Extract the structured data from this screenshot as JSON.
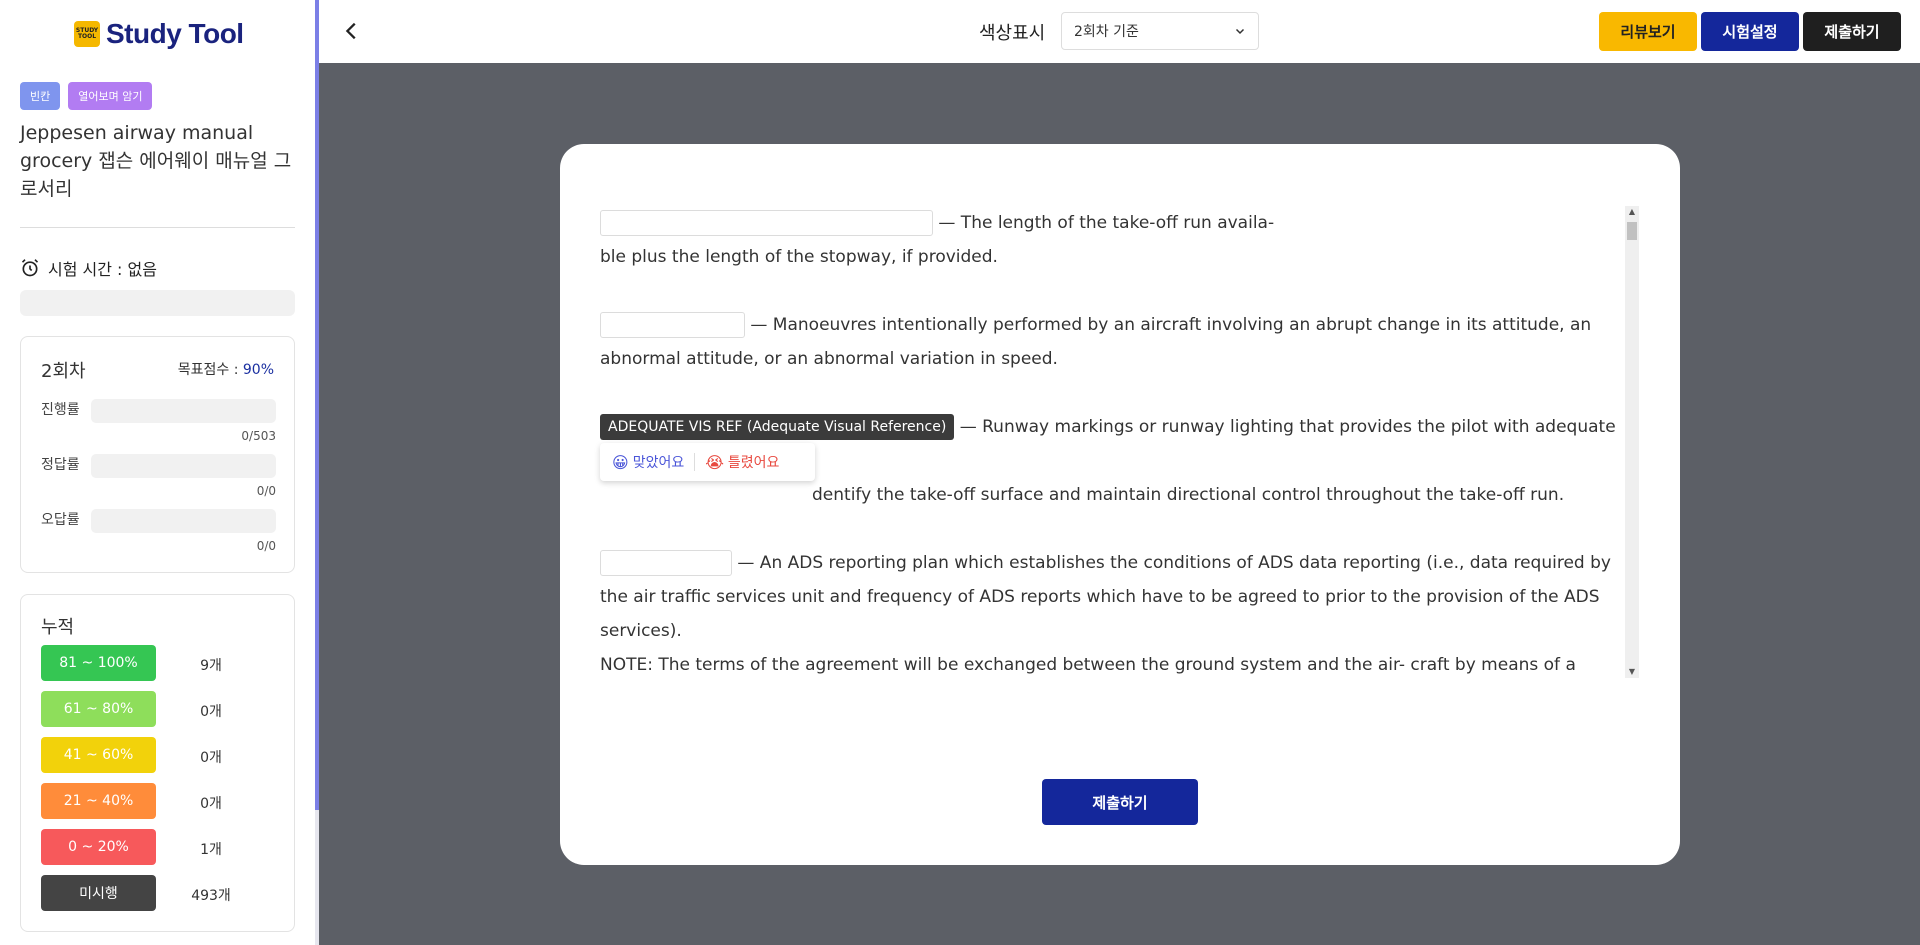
{
  "app": {
    "logo_badge": "STUDY TOOL",
    "logo_text": "Study Tool"
  },
  "sidebar": {
    "tags": [
      "빈칸",
      "열어보며 암기"
    ],
    "title": "Jeppesen airway manual grocery 잽슨 에어웨이 매뉴얼 그로서리",
    "timer_label": "시험 시간 : 없음",
    "round": {
      "name": "2회차",
      "goal_label": "목표점수 : ",
      "goal_value": "90%",
      "stats": [
        {
          "label": "진행률",
          "count": "0/503",
          "progress": 0
        },
        {
          "label": "정답률",
          "count": "0/0",
          "progress": 0
        },
        {
          "label": "오답률",
          "count": "0/0",
          "progress": 0
        }
      ]
    },
    "cumulative": {
      "title": "누적",
      "rows": [
        {
          "range": "81 ~ 100%",
          "count": "9개",
          "color": "#35c653"
        },
        {
          "range": "61 ~ 80%",
          "count": "0개",
          "color": "#8ede5b"
        },
        {
          "range": "41 ~ 60%",
          "count": "0개",
          "color": "#f2d20b"
        },
        {
          "range": "21 ~ 40%",
          "count": "0개",
          "color": "#ff8c3a"
        },
        {
          "range": "0 ~ 20%",
          "count": "1개",
          "color": "#f7595b"
        },
        {
          "range": "미시행",
          "count": "493개",
          "color": "#444444"
        }
      ]
    }
  },
  "topbar": {
    "color_label": "색상표시",
    "select_value": "2회차 기준",
    "review_label": "리뷰보기",
    "settings_label": "시험설정",
    "submit_label": "제출하기"
  },
  "quiz": {
    "items": [
      {
        "line1": "— The length of the take-off run availa-",
        "line2": "ble plus the length of the stopway, if provided."
      },
      {
        "text": "— Manoeuvres intentionally performed by an aircraft involving an abrupt change in its attitude, an abnormal attitude, or an abnormal variation in speed."
      },
      {
        "answer": "ADEQUATE VIS REF (Adequate Visual Reference)",
        "text1": "— Runway markings or runway lighting that provides the pilot with adequate visual",
        "text2": "dentify the take-off surface and maintain directional control throughout the take-off run."
      },
      {
        "text": "— An ADS reporting plan which establishes the conditions of ADS data reporting (i.e., data required by the air traffic services unit and frequency of ADS reports which have to be agreed to prior to the provision of the ADS services).",
        "note": "NOTE: The terms of the agreement will be exchanged between the ground system and the air- craft by means of a contract, or a series of contracts."
      }
    ],
    "feedback": {
      "correct": "맞았어요",
      "wrong": "틀렸어요"
    },
    "submit_label": "제출하기"
  }
}
